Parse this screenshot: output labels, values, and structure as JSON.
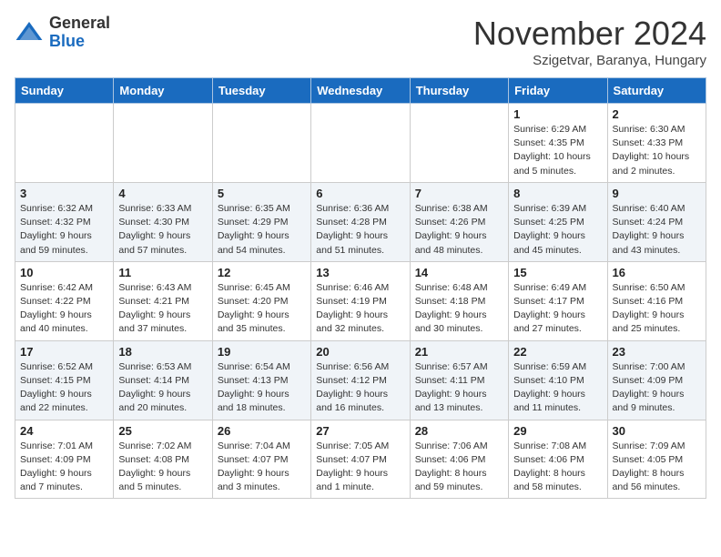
{
  "header": {
    "logo_general": "General",
    "logo_blue": "Blue",
    "month": "November 2024",
    "location": "Szigetvar, Baranya, Hungary"
  },
  "days_of_week": [
    "Sunday",
    "Monday",
    "Tuesday",
    "Wednesday",
    "Thursday",
    "Friday",
    "Saturday"
  ],
  "weeks": [
    [
      {
        "day": "",
        "detail": ""
      },
      {
        "day": "",
        "detail": ""
      },
      {
        "day": "",
        "detail": ""
      },
      {
        "day": "",
        "detail": ""
      },
      {
        "day": "",
        "detail": ""
      },
      {
        "day": "1",
        "detail": "Sunrise: 6:29 AM\nSunset: 4:35 PM\nDaylight: 10 hours and 5 minutes."
      },
      {
        "day": "2",
        "detail": "Sunrise: 6:30 AM\nSunset: 4:33 PM\nDaylight: 10 hours and 2 minutes."
      }
    ],
    [
      {
        "day": "3",
        "detail": "Sunrise: 6:32 AM\nSunset: 4:32 PM\nDaylight: 9 hours and 59 minutes."
      },
      {
        "day": "4",
        "detail": "Sunrise: 6:33 AM\nSunset: 4:30 PM\nDaylight: 9 hours and 57 minutes."
      },
      {
        "day": "5",
        "detail": "Sunrise: 6:35 AM\nSunset: 4:29 PM\nDaylight: 9 hours and 54 minutes."
      },
      {
        "day": "6",
        "detail": "Sunrise: 6:36 AM\nSunset: 4:28 PM\nDaylight: 9 hours and 51 minutes."
      },
      {
        "day": "7",
        "detail": "Sunrise: 6:38 AM\nSunset: 4:26 PM\nDaylight: 9 hours and 48 minutes."
      },
      {
        "day": "8",
        "detail": "Sunrise: 6:39 AM\nSunset: 4:25 PM\nDaylight: 9 hours and 45 minutes."
      },
      {
        "day": "9",
        "detail": "Sunrise: 6:40 AM\nSunset: 4:24 PM\nDaylight: 9 hours and 43 minutes."
      }
    ],
    [
      {
        "day": "10",
        "detail": "Sunrise: 6:42 AM\nSunset: 4:22 PM\nDaylight: 9 hours and 40 minutes."
      },
      {
        "day": "11",
        "detail": "Sunrise: 6:43 AM\nSunset: 4:21 PM\nDaylight: 9 hours and 37 minutes."
      },
      {
        "day": "12",
        "detail": "Sunrise: 6:45 AM\nSunset: 4:20 PM\nDaylight: 9 hours and 35 minutes."
      },
      {
        "day": "13",
        "detail": "Sunrise: 6:46 AM\nSunset: 4:19 PM\nDaylight: 9 hours and 32 minutes."
      },
      {
        "day": "14",
        "detail": "Sunrise: 6:48 AM\nSunset: 4:18 PM\nDaylight: 9 hours and 30 minutes."
      },
      {
        "day": "15",
        "detail": "Sunrise: 6:49 AM\nSunset: 4:17 PM\nDaylight: 9 hours and 27 minutes."
      },
      {
        "day": "16",
        "detail": "Sunrise: 6:50 AM\nSunset: 4:16 PM\nDaylight: 9 hours and 25 minutes."
      }
    ],
    [
      {
        "day": "17",
        "detail": "Sunrise: 6:52 AM\nSunset: 4:15 PM\nDaylight: 9 hours and 22 minutes."
      },
      {
        "day": "18",
        "detail": "Sunrise: 6:53 AM\nSunset: 4:14 PM\nDaylight: 9 hours and 20 minutes."
      },
      {
        "day": "19",
        "detail": "Sunrise: 6:54 AM\nSunset: 4:13 PM\nDaylight: 9 hours and 18 minutes."
      },
      {
        "day": "20",
        "detail": "Sunrise: 6:56 AM\nSunset: 4:12 PM\nDaylight: 9 hours and 16 minutes."
      },
      {
        "day": "21",
        "detail": "Sunrise: 6:57 AM\nSunset: 4:11 PM\nDaylight: 9 hours and 13 minutes."
      },
      {
        "day": "22",
        "detail": "Sunrise: 6:59 AM\nSunset: 4:10 PM\nDaylight: 9 hours and 11 minutes."
      },
      {
        "day": "23",
        "detail": "Sunrise: 7:00 AM\nSunset: 4:09 PM\nDaylight: 9 hours and 9 minutes."
      }
    ],
    [
      {
        "day": "24",
        "detail": "Sunrise: 7:01 AM\nSunset: 4:09 PM\nDaylight: 9 hours and 7 minutes."
      },
      {
        "day": "25",
        "detail": "Sunrise: 7:02 AM\nSunset: 4:08 PM\nDaylight: 9 hours and 5 minutes."
      },
      {
        "day": "26",
        "detail": "Sunrise: 7:04 AM\nSunset: 4:07 PM\nDaylight: 9 hours and 3 minutes."
      },
      {
        "day": "27",
        "detail": "Sunrise: 7:05 AM\nSunset: 4:07 PM\nDaylight: 9 hours and 1 minute."
      },
      {
        "day": "28",
        "detail": "Sunrise: 7:06 AM\nSunset: 4:06 PM\nDaylight: 8 hours and 59 minutes."
      },
      {
        "day": "29",
        "detail": "Sunrise: 7:08 AM\nSunset: 4:06 PM\nDaylight: 8 hours and 58 minutes."
      },
      {
        "day": "30",
        "detail": "Sunrise: 7:09 AM\nSunset: 4:05 PM\nDaylight: 8 hours and 56 minutes."
      }
    ]
  ]
}
